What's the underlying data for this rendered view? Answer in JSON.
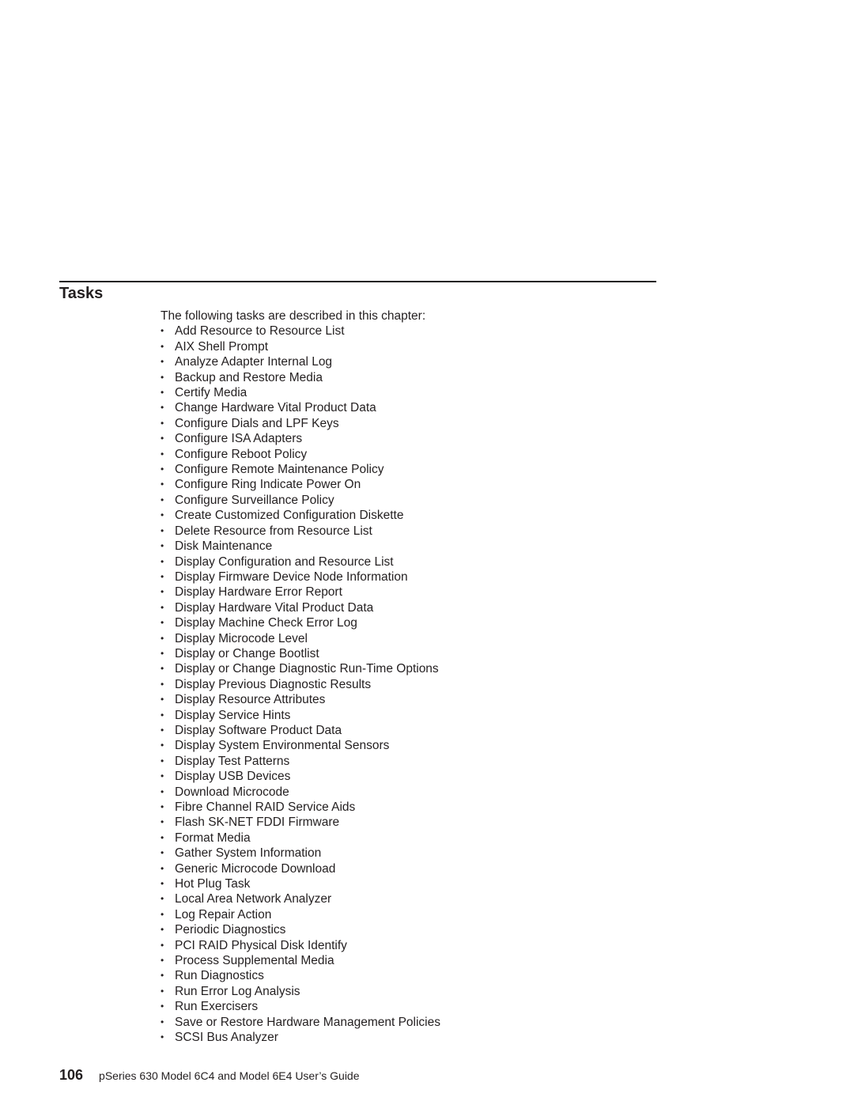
{
  "section": {
    "title": "Tasks",
    "intro": "The following tasks are described in this chapter:",
    "bullet_icon": "bullet-icon",
    "tasks": [
      "Add Resource to Resource List",
      "AIX Shell Prompt",
      "Analyze Adapter Internal Log",
      "Backup and Restore Media",
      "Certify Media",
      "Change Hardware Vital Product Data",
      "Configure Dials and LPF Keys",
      "Configure ISA Adapters",
      "Configure Reboot Policy",
      "Configure Remote Maintenance Policy",
      "Configure Ring Indicate Power On",
      "Configure Surveillance Policy",
      "Create Customized Configuration Diskette",
      "Delete Resource from Resource List",
      "Disk Maintenance",
      "Display Configuration and Resource List",
      "Display Firmware Device Node Information",
      "Display Hardware Error Report",
      "Display Hardware Vital Product Data",
      "Display Machine Check Error Log",
      "Display Microcode Level",
      "Display or Change Bootlist",
      "Display or Change Diagnostic Run-Time Options",
      "Display Previous Diagnostic Results",
      "Display Resource Attributes",
      "Display Service Hints",
      "Display Software Product Data",
      "Display System Environmental Sensors",
      "Display Test Patterns",
      "Display USB Devices",
      "Download Microcode",
      "Fibre Channel RAID Service Aids",
      "Flash SK-NET FDDI Firmware",
      "Format Media",
      "Gather System Information",
      "Generic Microcode Download",
      "Hot Plug Task",
      "Local Area Network Analyzer",
      "Log Repair Action",
      "Periodic Diagnostics",
      "PCI RAID Physical Disk Identify",
      "Process Supplemental Media",
      "Run Diagnostics",
      "Run Error Log Analysis",
      "Run Exercisers",
      "Save or Restore Hardware Management Policies",
      "SCSI Bus Analyzer"
    ]
  },
  "footer": {
    "page_number": "106",
    "book_title": "pSeries 630 Model 6C4 and Model 6E4 User’s Guide"
  }
}
